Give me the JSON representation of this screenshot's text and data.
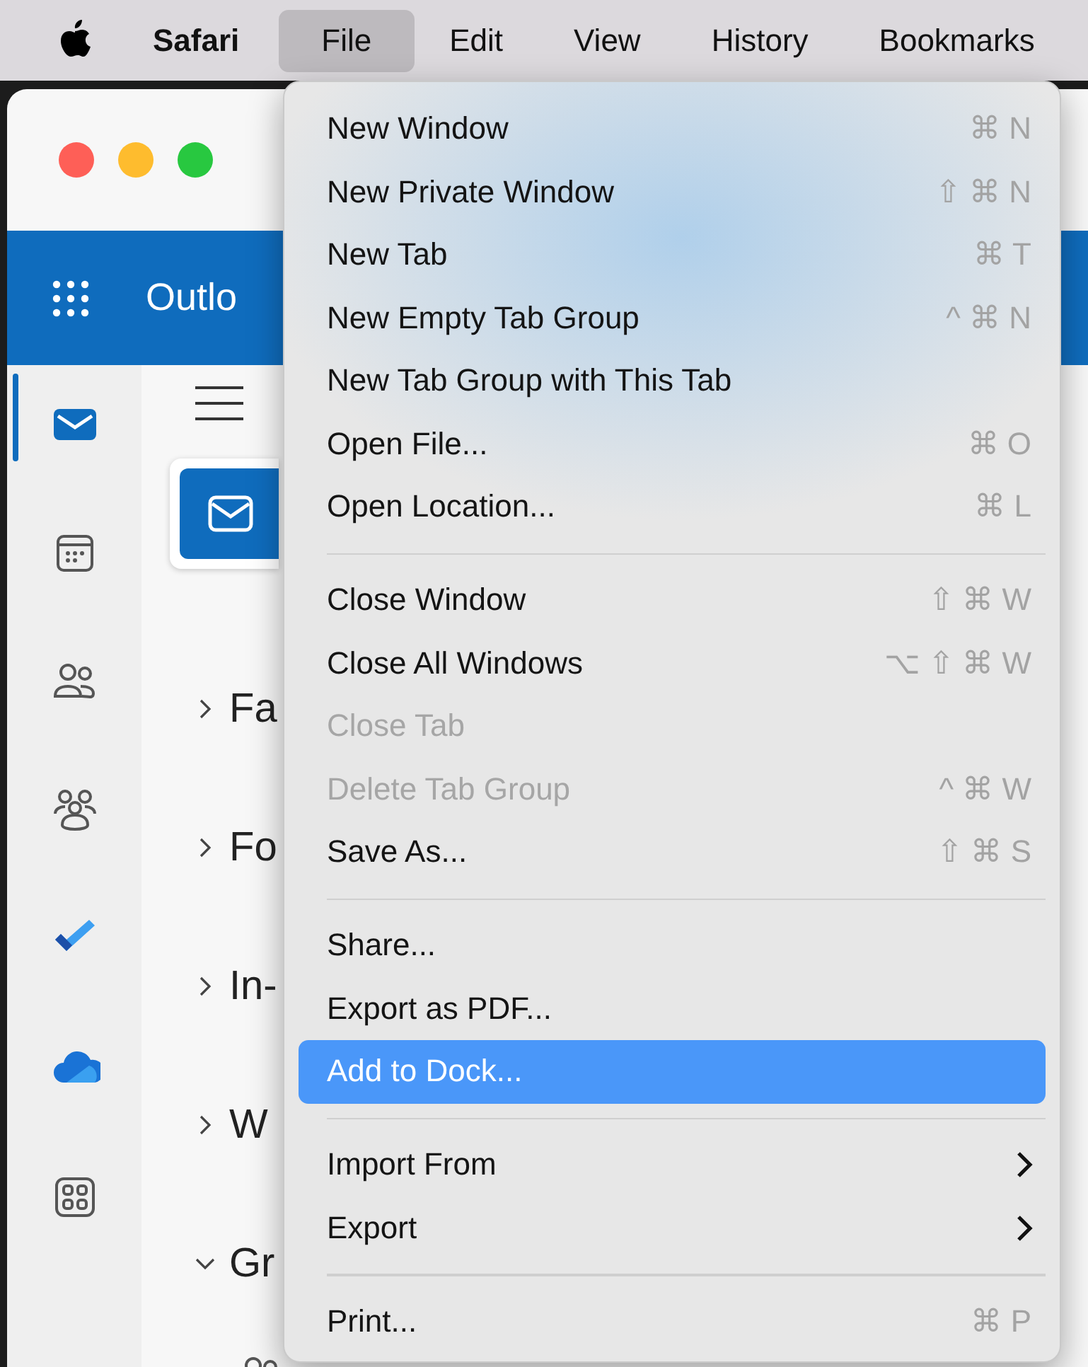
{
  "menu_bar": [
    {
      "kind": "apple",
      "selected": false
    },
    {
      "kind": "app",
      "label": "Safari",
      "selected": false
    },
    {
      "kind": "menu",
      "label": "File",
      "selected": true
    },
    {
      "kind": "menu",
      "label": "Edit",
      "selected": false
    },
    {
      "kind": "menu",
      "label": "View",
      "selected": false
    },
    {
      "kind": "menu",
      "label": "History",
      "selected": false
    },
    {
      "kind": "menu",
      "label": "Bookmarks",
      "selected": false
    }
  ],
  "outlook": {
    "app_title": "Outlo",
    "rail": [
      {
        "kind": "mail",
        "selected": true
      },
      {
        "kind": "calendar",
        "selected": false
      },
      {
        "kind": "people",
        "selected": false
      },
      {
        "kind": "groups",
        "selected": false
      },
      {
        "kind": "todo",
        "selected": false
      },
      {
        "kind": "onedrive",
        "selected": false
      },
      {
        "kind": "apps",
        "selected": false
      }
    ],
    "folders": [
      {
        "label": "Fa",
        "expanded": false
      },
      {
        "label": "Fo",
        "expanded": false
      },
      {
        "label": "In-",
        "expanded": false
      },
      {
        "label": "W",
        "expanded": false
      },
      {
        "label": "Gr",
        "expanded": true
      }
    ]
  },
  "file_menu": [
    {
      "kind": "item",
      "label": "New Window",
      "shortcut": "⌘ N",
      "disabled": false,
      "selected": false,
      "submenu": false
    },
    {
      "kind": "item",
      "label": "New Private Window",
      "shortcut": "⇧ ⌘ N",
      "disabled": false,
      "selected": false,
      "submenu": false
    },
    {
      "kind": "item",
      "label": "New Tab",
      "shortcut": "⌘ T",
      "disabled": false,
      "selected": false,
      "submenu": false
    },
    {
      "kind": "item",
      "label": "New Empty Tab Group",
      "shortcut": "^ ⌘ N",
      "disabled": false,
      "selected": false,
      "submenu": false
    },
    {
      "kind": "item",
      "label": "New Tab Group with This Tab",
      "disabled": false,
      "selected": false,
      "submenu": false
    },
    {
      "kind": "item",
      "label": "Open File...",
      "shortcut": "⌘ O",
      "disabled": false,
      "selected": false,
      "submenu": false
    },
    {
      "kind": "item",
      "label": "Open Location...",
      "shortcut": "⌘ L",
      "disabled": false,
      "selected": false,
      "submenu": false
    },
    {
      "kind": "separator"
    },
    {
      "kind": "item",
      "label": "Close Window",
      "shortcut": "⇧ ⌘ W",
      "disabled": false,
      "selected": false,
      "submenu": false
    },
    {
      "kind": "item",
      "label": "Close All Windows",
      "shortcut": "⌥ ⇧ ⌘ W",
      "disabled": false,
      "selected": false,
      "submenu": false
    },
    {
      "kind": "item",
      "label": "Close Tab",
      "disabled": true,
      "selected": false,
      "submenu": false
    },
    {
      "kind": "item",
      "label": "Delete Tab Group",
      "shortcut": "^ ⌘ W",
      "disabled": true,
      "selected": false,
      "submenu": false
    },
    {
      "kind": "item",
      "label": "Save As...",
      "shortcut": "⇧ ⌘ S",
      "disabled": false,
      "selected": false,
      "submenu": false
    },
    {
      "kind": "separator"
    },
    {
      "kind": "item",
      "label": "Share...",
      "disabled": false,
      "selected": false,
      "submenu": false
    },
    {
      "kind": "item",
      "label": "Export as PDF...",
      "disabled": false,
      "selected": false,
      "submenu": false
    },
    {
      "kind": "item",
      "label": "Add to Dock...",
      "disabled": false,
      "selected": true,
      "submenu": false
    },
    {
      "kind": "separator"
    },
    {
      "kind": "item",
      "label": "Import From",
      "disabled": false,
      "selected": false,
      "submenu": true
    },
    {
      "kind": "item",
      "label": "Export",
      "disabled": false,
      "selected": false,
      "submenu": true
    },
    {
      "kind": "separator"
    },
    {
      "kind": "item",
      "label": "Print...",
      "shortcut": "⌘ P",
      "disabled": false,
      "selected": false,
      "submenu": false
    }
  ]
}
